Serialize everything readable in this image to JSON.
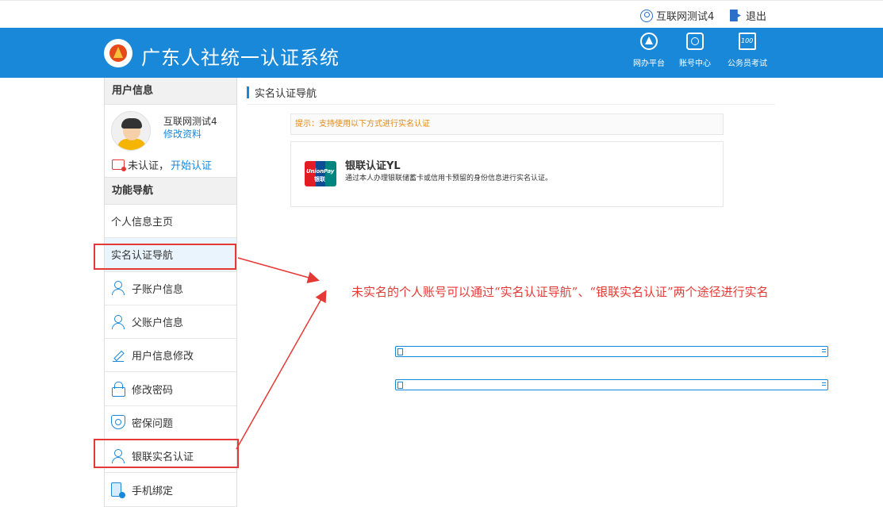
{
  "topbar": {
    "user_name": "互联网测试4",
    "logout_label": "退出"
  },
  "header": {
    "site_title": "广东人社统一认证系统",
    "nav": [
      {
        "label": "网办平台",
        "icon": "platform-icon"
      },
      {
        "label": "账号中心",
        "icon": "account-center-icon"
      },
      {
        "label": "公务员考试",
        "icon": "exam-icon"
      }
    ]
  },
  "sidebar": {
    "user_section_title": "用户信息",
    "user_name": "互联网测试4",
    "edit_profile": "修改资料",
    "status_text": "未认证，",
    "status_link": "开始认证",
    "nav_section_title": "功能导航",
    "items": [
      {
        "label": "个人信息主页",
        "icon": "id-card-icon"
      },
      {
        "label": "实名认证导航",
        "icon": "id-card-icon"
      },
      {
        "label": "子账户信息",
        "icon": "person-add-icon"
      },
      {
        "label": "父账户信息",
        "icon": "person-icon"
      },
      {
        "label": "用户信息修改",
        "icon": "pencil-icon"
      },
      {
        "label": "修改密码",
        "icon": "lock-icon"
      },
      {
        "label": "密保问题",
        "icon": "shield-icon"
      },
      {
        "label": "银联实名认证",
        "icon": "person-check-icon"
      },
      {
        "label": "手机绑定",
        "icon": "phone-icon"
      }
    ]
  },
  "main": {
    "breadcrumb": "实名认证导航",
    "tip": "提示：支持使用以下方式进行实名认证",
    "card": {
      "title": "银联认证YL",
      "desc": "通过本人办理银联储蓄卡或信用卡预留的身份信息进行实名认证。",
      "logo_text_1": "UnionPay",
      "logo_text_2": "银联"
    }
  },
  "annotation": {
    "text": "未实名的个人账号可以通过“实名认证导航”、“银联实名认证”两个途径进行实名",
    "color": "#e53935"
  },
  "colors": {
    "accent": "#1a88d8",
    "highlight": "#e53935"
  }
}
